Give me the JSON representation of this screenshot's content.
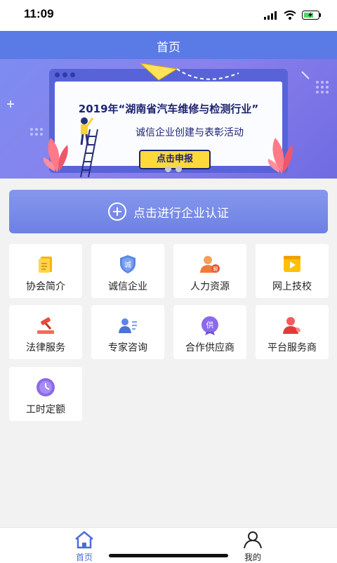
{
  "status_bar": {
    "time": "11:09"
  },
  "header": {
    "title": "首页"
  },
  "banner": {
    "title": "2019年“湖南省汽车维修与检测行业”",
    "subtitle": "诚信企业创建与表彰活动",
    "button_label": "点击申报"
  },
  "auth_button": {
    "label": "点击进行企业认证"
  },
  "grid": [
    {
      "label": "协会简介",
      "icon": "document-icon"
    },
    {
      "label": "诚信企业",
      "icon": "shield-icon"
    },
    {
      "label": "人力资源",
      "icon": "person-chat-icon"
    },
    {
      "label": "网上技校",
      "icon": "video-icon"
    },
    {
      "label": "法律服务",
      "icon": "gavel-icon"
    },
    {
      "label": "专家咨询",
      "icon": "expert-card-icon"
    },
    {
      "label": "合作供应商",
      "icon": "supplier-badge-icon"
    },
    {
      "label": "平台服务商",
      "icon": "service-person-icon"
    },
    {
      "label": "工时定额",
      "icon": "clock-icon"
    }
  ],
  "icon_glyphs": {
    "shield": "诚",
    "person_chat": "聊",
    "supplier": "供"
  },
  "tabbar": {
    "items": [
      {
        "label": "首页",
        "icon": "home-icon",
        "active": true
      },
      {
        "label": "我的",
        "icon": "user-icon",
        "active": false
      }
    ]
  },
  "colors": {
    "primary": "#5a7ae6",
    "active_tab": "#4b6cd8"
  }
}
